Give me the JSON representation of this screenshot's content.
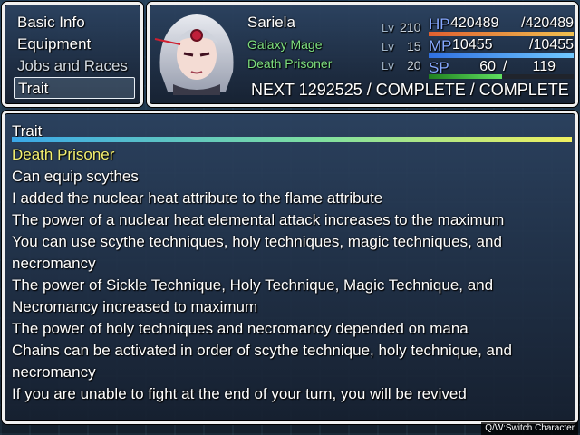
{
  "menu": {
    "items": [
      {
        "label": "Basic Info"
      },
      {
        "label": "Equipment"
      },
      {
        "label": "Jobs and Races"
      },
      {
        "label": "Trait"
      }
    ],
    "selected": "Trait"
  },
  "actor": {
    "name": "Sariela",
    "level_label": "Lv",
    "classes": [
      {
        "name": "Galaxy Mage",
        "level": "15"
      },
      {
        "name": "Death Prisoner",
        "level": "20"
      }
    ],
    "main_level": "210",
    "hp": {
      "label": "HP",
      "value": "420489",
      "max": "420489"
    },
    "mp": {
      "label": "MP",
      "value": "10455",
      "max": "10455"
    },
    "sp": {
      "label": "SP",
      "value": "60",
      "max": "119"
    },
    "next": "NEXT 1292525 / COMPLETE / COMPLETE"
  },
  "trait": {
    "title": "Trait",
    "name": "Death Prisoner",
    "lines": [
      "Can equip scythes",
      "I added the nuclear heat attribute to the flame attribute",
      "The power of a nuclear heat elemental attack increases to the maximum",
      "You can use scythe techniques, holy techniques, magic techniques, and",
      "necromancy",
      "The power of Sickle Technique, Holy Technique, Magic Technique, and",
      "Necromancy increased to maximum",
      "The power of holy techniques and necromancy depended on mana",
      "Chains can be activated in order of scythe technique, holy technique, and",
      "necromancy",
      "If you are unable to fight at the end of your turn, you will be revived"
    ]
  },
  "hint": "Q/W:Switch Character",
  "colors": {
    "hp_gauge": "#f0a040",
    "mp_gauge": "#48a0f0",
    "sp_gauge": "#40c040",
    "class_text": "#7ee07e",
    "trait_name": "#f4f070"
  },
  "icons": {
    "portrait": "character-portrait"
  }
}
